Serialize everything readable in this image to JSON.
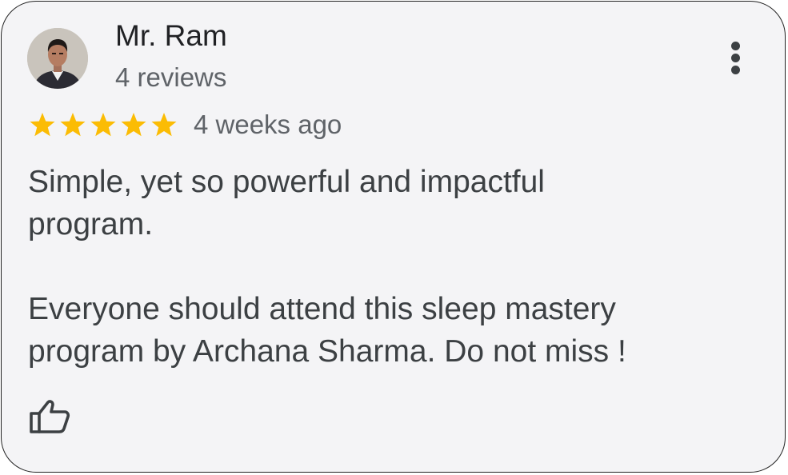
{
  "review": {
    "reviewer_name": "Mr. Ram",
    "review_count": "4 reviews",
    "rating": 5,
    "rating_max": 5,
    "date": "4 weeks ago",
    "text_lines": [
      "Simple, yet so powerful and impactful",
      "program.",
      "",
      "Everyone should attend this sleep mastery",
      "program by Archana Sharma. Do not miss !"
    ]
  },
  "icons": {
    "avatar": "avatar-photo",
    "more": "more-vertical-icon",
    "star": "star-icon",
    "like": "thumbs-up-icon"
  },
  "colors": {
    "card_background": "#f4f4f6",
    "star_fill": "#fbbc04",
    "name_text": "#202124",
    "secondary_text": "#5f6368",
    "body_text": "#3c4043"
  }
}
